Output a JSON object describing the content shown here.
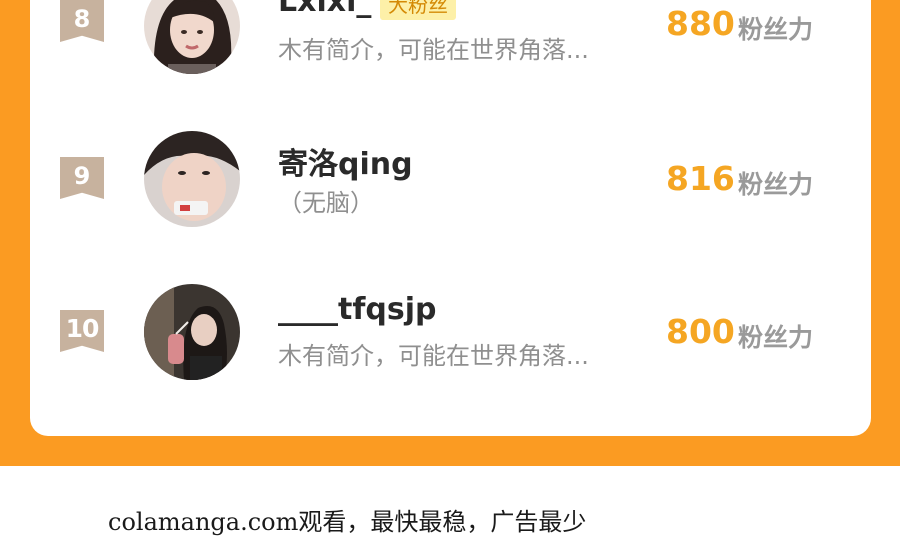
{
  "leaderboard": {
    "entries": [
      {
        "rank": "8",
        "username": "Lxlxl_",
        "tag": "大粉丝",
        "intro": "木有简介，可能在世界角落...",
        "fan_power": "880",
        "fan_power_unit": "粉丝力"
      },
      {
        "rank": "9",
        "username": "寄洛qing",
        "intro": "（无脑）",
        "fan_power": "816",
        "fan_power_unit": "粉丝力"
      },
      {
        "rank": "10",
        "username": "____tfqsjp",
        "intro": "木有简介，可能在世界角落...",
        "fan_power": "800",
        "fan_power_unit": "粉丝力"
      }
    ]
  },
  "footer": {
    "text": "colamanga.com观看，最快最稳，广告最少"
  },
  "colors": {
    "frame": "#fb9b22",
    "rank_badge": "#c7b29e",
    "fan_power": "#f5a623",
    "tag_bg": "#fdf0a8"
  }
}
